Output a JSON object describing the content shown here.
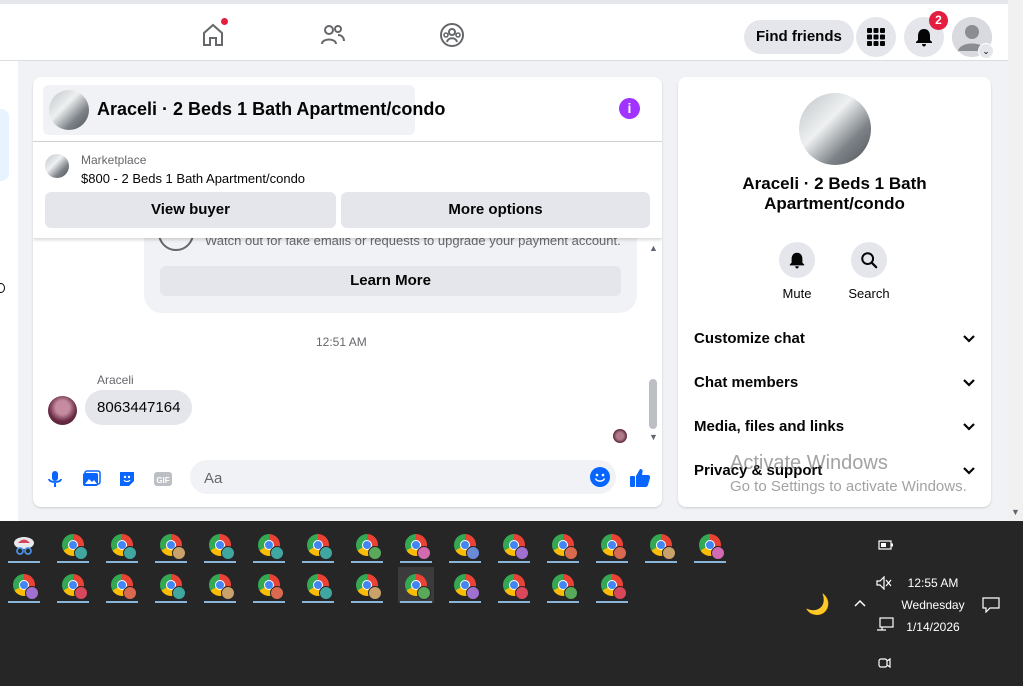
{
  "topbar": {
    "find_friends": "Find friends",
    "notification_count": "2",
    "icons": [
      "home-icon",
      "friends-icon",
      "groups-icon",
      "menu-grid-icon",
      "bell-icon",
      "avatar"
    ]
  },
  "chat": {
    "title": "Araceli · 2 Beds 1 Bath Apartment/condo",
    "marketplace": {
      "label": "Marketplace",
      "listing": "$800 - 2 Beds 1 Bath Apartment/condo",
      "view_buyer": "View buyer",
      "more_options": "More options"
    },
    "warning": {
      "text": "Watch out for fake emails or requests to upgrade your payment account.",
      "learn_more": "Learn More"
    },
    "timestamp": "12:51 AM",
    "messages": [
      {
        "sender": "Araceli",
        "text": "8063447164"
      }
    ],
    "composer": {
      "placeholder": "Aa"
    }
  },
  "right_panel": {
    "title": "Araceli · 2 Beds 1 Bath Apartment/condo",
    "actions": [
      {
        "label": "Mute",
        "icon": "bell-icon"
      },
      {
        "label": "Search",
        "icon": "search-icon"
      }
    ],
    "sections": [
      "Customize chat",
      "Chat members",
      "Media, files and links",
      "Privacy & support"
    ]
  },
  "watermark": {
    "line1": "Activate Windows",
    "line2": "Go to Settings to activate Windows."
  },
  "taskbar": {
    "time": "12:55 AM",
    "day": "Wednesday",
    "date": "1/14/2026",
    "profile_colors_row1": [
      "#c9a16a",
      "#3fa7a0",
      "#3fa7a0",
      "#c9a16a",
      "#3fa7a0",
      "#3fa7a0",
      "#3fa7a0",
      "#5aa85a",
      "#d16ab0",
      "#6a8ad6",
      "#a070d0",
      "#d96a50",
      "#d96a50",
      "#c9a16a",
      "#d16ab0"
    ],
    "profile_colors_row2": [
      "#a070d0",
      "#d9485a",
      "#d96a50",
      "#3fa7a0",
      "#c9a16a",
      "#d96a50",
      "#3fa7a0",
      "#c9a16a",
      "#5aa85a",
      "#a070d0",
      "#d9485a",
      "#5aa85a",
      "#d9485a"
    ]
  }
}
